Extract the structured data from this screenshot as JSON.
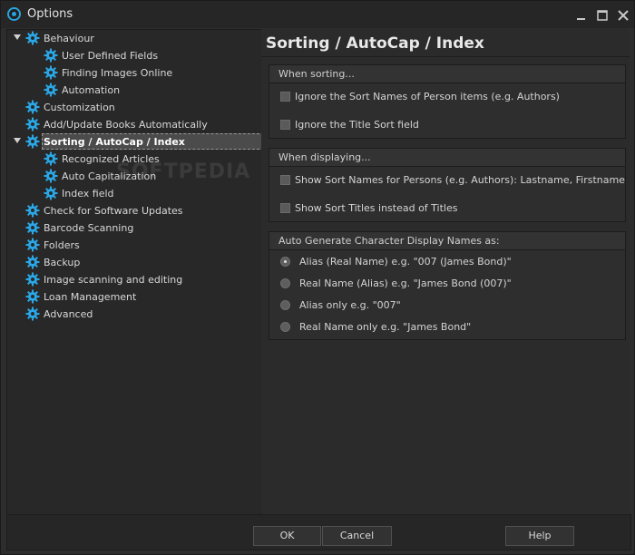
{
  "window": {
    "title": "Options"
  },
  "tree": [
    {
      "label": "Behaviour",
      "expanded": true,
      "level": 0
    },
    {
      "label": "User Defined Fields",
      "level": 1
    },
    {
      "label": "Finding Images Online",
      "level": 1
    },
    {
      "label": "Automation",
      "level": 1
    },
    {
      "label": "Customization",
      "level": 0
    },
    {
      "label": "Add/Update Books Automatically",
      "level": 0
    },
    {
      "label": "Sorting / AutoCap / Index",
      "expanded": true,
      "level": 0,
      "selected": true
    },
    {
      "label": "Recognized Articles",
      "level": 1
    },
    {
      "label": "Auto Capitalization",
      "level": 1
    },
    {
      "label": "Index field",
      "level": 1
    },
    {
      "label": "Check for Software Updates",
      "level": 0
    },
    {
      "label": "Barcode Scanning",
      "level": 0
    },
    {
      "label": "Folders",
      "level": 0
    },
    {
      "label": "Backup",
      "level": 0
    },
    {
      "label": "Image scanning and editing",
      "level": 0
    },
    {
      "label": "Loan Management",
      "level": 0
    },
    {
      "label": "Advanced",
      "level": 0
    }
  ],
  "page": {
    "title": "Sorting / AutoCap / Index",
    "sorting": {
      "header": "When sorting...",
      "options": [
        {
          "label": "Ignore the Sort Names of Person items (e.g. Authors)",
          "checked": false
        },
        {
          "label": "Ignore the Title Sort field",
          "checked": false
        }
      ]
    },
    "displaying": {
      "header": "When displaying...",
      "options": [
        {
          "label": "Show Sort Names for Persons (e.g. Authors): Lastname, Firstname",
          "checked": false
        },
        {
          "label": "Show Sort Titles instead of Titles",
          "checked": false
        }
      ]
    },
    "autogen": {
      "header": "Auto Generate Character Display Names as:",
      "options": [
        {
          "label": "Alias (Real Name) e.g. \"007 (James Bond)\"",
          "selected": true
        },
        {
          "label": "Real Name (Alias) e.g. \"James Bond (007)\"",
          "selected": false
        },
        {
          "label": "Alias only e.g. \"007\"",
          "selected": false
        },
        {
          "label": "Real Name only e.g. \"James Bond\"",
          "selected": false
        }
      ]
    }
  },
  "buttons": {
    "ok": "OK",
    "cancel": "Cancel",
    "help": "Help"
  },
  "watermark": "SOFTPEDIA",
  "colors": {
    "gear": "#2aa7e6",
    "background": "#2b2b2b",
    "selection": "#4b4b4b"
  }
}
